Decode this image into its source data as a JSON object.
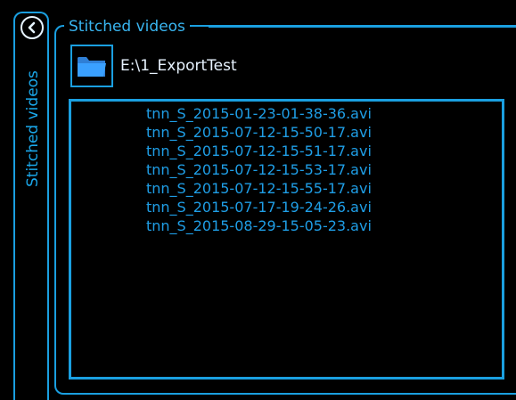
{
  "side_tab": {
    "label": "Stitched videos"
  },
  "group": {
    "title": "Stitched videos"
  },
  "export": {
    "path": "E:\\1_ExportTest"
  },
  "files": [
    "tnn_S_2015-01-23-01-38-36.avi",
    "tnn_S_2015-07-12-15-50-17.avi",
    "tnn_S_2015-07-12-15-51-17.avi",
    "tnn_S_2015-07-12-15-53-17.avi",
    "tnn_S_2015-07-12-15-55-17.avi",
    "tnn_S_2015-07-17-19-24-26.avi",
    "tnn_S_2015-08-29-15-05-23.avi"
  ],
  "colors": {
    "accent": "#1a9fe0",
    "text_light": "#e8f3ff",
    "background": "#000000"
  },
  "icons": {
    "back": "chevron-left-icon",
    "folder": "folder-icon"
  }
}
